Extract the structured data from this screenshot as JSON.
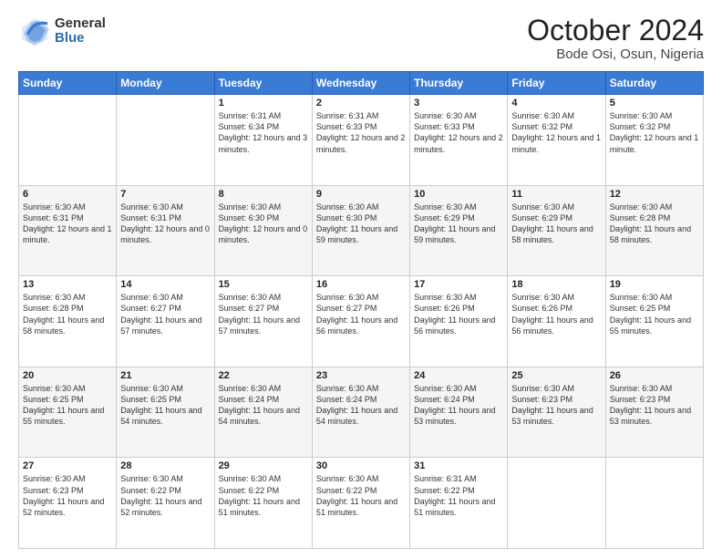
{
  "header": {
    "logo_general": "General",
    "logo_blue": "Blue",
    "title": "October 2024",
    "location": "Bode Osi, Osun, Nigeria"
  },
  "days_of_week": [
    "Sunday",
    "Monday",
    "Tuesday",
    "Wednesday",
    "Thursday",
    "Friday",
    "Saturday"
  ],
  "weeks": [
    [
      {
        "day": "",
        "info": ""
      },
      {
        "day": "",
        "info": ""
      },
      {
        "day": "1",
        "info": "Sunrise: 6:31 AM\nSunset: 6:34 PM\nDaylight: 12 hours and 3 minutes."
      },
      {
        "day": "2",
        "info": "Sunrise: 6:31 AM\nSunset: 6:33 PM\nDaylight: 12 hours and 2 minutes."
      },
      {
        "day": "3",
        "info": "Sunrise: 6:30 AM\nSunset: 6:33 PM\nDaylight: 12 hours and 2 minutes."
      },
      {
        "day": "4",
        "info": "Sunrise: 6:30 AM\nSunset: 6:32 PM\nDaylight: 12 hours and 1 minute."
      },
      {
        "day": "5",
        "info": "Sunrise: 6:30 AM\nSunset: 6:32 PM\nDaylight: 12 hours and 1 minute."
      }
    ],
    [
      {
        "day": "6",
        "info": "Sunrise: 6:30 AM\nSunset: 6:31 PM\nDaylight: 12 hours and 1 minute."
      },
      {
        "day": "7",
        "info": "Sunrise: 6:30 AM\nSunset: 6:31 PM\nDaylight: 12 hours and 0 minutes."
      },
      {
        "day": "8",
        "info": "Sunrise: 6:30 AM\nSunset: 6:30 PM\nDaylight: 12 hours and 0 minutes."
      },
      {
        "day": "9",
        "info": "Sunrise: 6:30 AM\nSunset: 6:30 PM\nDaylight: 11 hours and 59 minutes."
      },
      {
        "day": "10",
        "info": "Sunrise: 6:30 AM\nSunset: 6:29 PM\nDaylight: 11 hours and 59 minutes."
      },
      {
        "day": "11",
        "info": "Sunrise: 6:30 AM\nSunset: 6:29 PM\nDaylight: 11 hours and 58 minutes."
      },
      {
        "day": "12",
        "info": "Sunrise: 6:30 AM\nSunset: 6:28 PM\nDaylight: 11 hours and 58 minutes."
      }
    ],
    [
      {
        "day": "13",
        "info": "Sunrise: 6:30 AM\nSunset: 6:28 PM\nDaylight: 11 hours and 58 minutes."
      },
      {
        "day": "14",
        "info": "Sunrise: 6:30 AM\nSunset: 6:27 PM\nDaylight: 11 hours and 57 minutes."
      },
      {
        "day": "15",
        "info": "Sunrise: 6:30 AM\nSunset: 6:27 PM\nDaylight: 11 hours and 57 minutes."
      },
      {
        "day": "16",
        "info": "Sunrise: 6:30 AM\nSunset: 6:27 PM\nDaylight: 11 hours and 56 minutes."
      },
      {
        "day": "17",
        "info": "Sunrise: 6:30 AM\nSunset: 6:26 PM\nDaylight: 11 hours and 56 minutes."
      },
      {
        "day": "18",
        "info": "Sunrise: 6:30 AM\nSunset: 6:26 PM\nDaylight: 11 hours and 56 minutes."
      },
      {
        "day": "19",
        "info": "Sunrise: 6:30 AM\nSunset: 6:25 PM\nDaylight: 11 hours and 55 minutes."
      }
    ],
    [
      {
        "day": "20",
        "info": "Sunrise: 6:30 AM\nSunset: 6:25 PM\nDaylight: 11 hours and 55 minutes."
      },
      {
        "day": "21",
        "info": "Sunrise: 6:30 AM\nSunset: 6:25 PM\nDaylight: 11 hours and 54 minutes."
      },
      {
        "day": "22",
        "info": "Sunrise: 6:30 AM\nSunset: 6:24 PM\nDaylight: 11 hours and 54 minutes."
      },
      {
        "day": "23",
        "info": "Sunrise: 6:30 AM\nSunset: 6:24 PM\nDaylight: 11 hours and 54 minutes."
      },
      {
        "day": "24",
        "info": "Sunrise: 6:30 AM\nSunset: 6:24 PM\nDaylight: 11 hours and 53 minutes."
      },
      {
        "day": "25",
        "info": "Sunrise: 6:30 AM\nSunset: 6:23 PM\nDaylight: 11 hours and 53 minutes."
      },
      {
        "day": "26",
        "info": "Sunrise: 6:30 AM\nSunset: 6:23 PM\nDaylight: 11 hours and 53 minutes."
      }
    ],
    [
      {
        "day": "27",
        "info": "Sunrise: 6:30 AM\nSunset: 6:23 PM\nDaylight: 11 hours and 52 minutes."
      },
      {
        "day": "28",
        "info": "Sunrise: 6:30 AM\nSunset: 6:22 PM\nDaylight: 11 hours and 52 minutes."
      },
      {
        "day": "29",
        "info": "Sunrise: 6:30 AM\nSunset: 6:22 PM\nDaylight: 11 hours and 51 minutes."
      },
      {
        "day": "30",
        "info": "Sunrise: 6:30 AM\nSunset: 6:22 PM\nDaylight: 11 hours and 51 minutes."
      },
      {
        "day": "31",
        "info": "Sunrise: 6:31 AM\nSunset: 6:22 PM\nDaylight: 11 hours and 51 minutes."
      },
      {
        "day": "",
        "info": ""
      },
      {
        "day": "",
        "info": ""
      }
    ]
  ]
}
